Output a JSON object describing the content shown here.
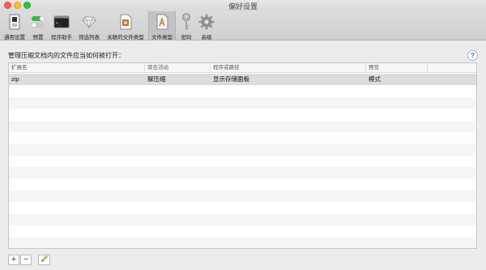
{
  "window": {
    "title": "偏好设置"
  },
  "toolbar": {
    "items": [
      {
        "label": "通用设置",
        "icon": "general-switch-icon"
      },
      {
        "label": "预置",
        "icon": "toggle-icon"
      },
      {
        "label": "程序助手",
        "icon": "terminal-icon"
      },
      {
        "label": "筛选列表",
        "icon": "diamond-filter-icon"
      },
      {
        "label": "关联的文件类型",
        "icon": "file-association-icon"
      },
      {
        "label": "文件类型",
        "icon": "file-type-icon"
      },
      {
        "label": "密码",
        "icon": "key-icon"
      },
      {
        "label": "高级",
        "icon": "gear-icon"
      }
    ]
  },
  "main": {
    "heading": "管理压缩文档内的文件应当如何被打开：",
    "help": "?",
    "table": {
      "columns": [
        "扩展名",
        "双击活动",
        "程序或路径",
        "预览"
      ],
      "rows": [
        [
          "zip",
          "解压缩",
          "显示存储面板",
          "模式"
        ]
      ]
    }
  },
  "footer": {
    "add_label": "+",
    "remove_label": "−"
  }
}
